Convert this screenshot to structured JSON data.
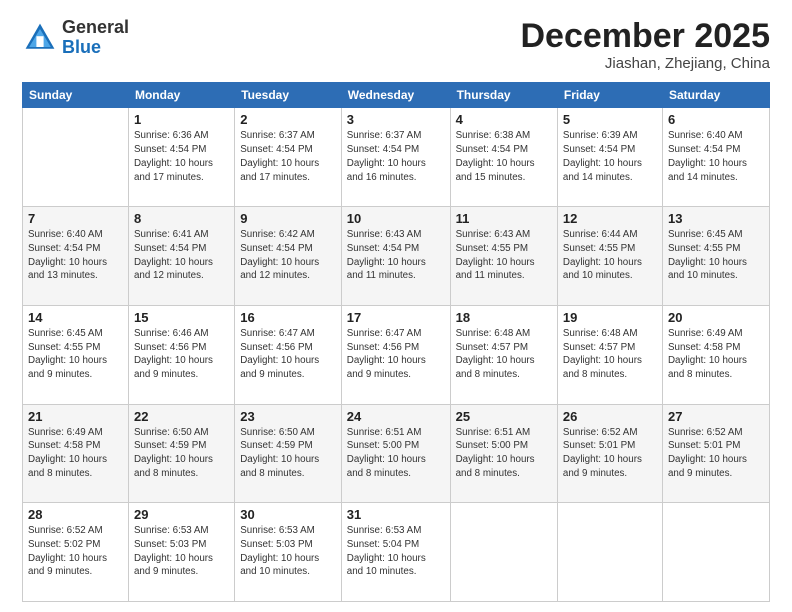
{
  "logo": {
    "general": "General",
    "blue": "Blue"
  },
  "title": {
    "month": "December 2025",
    "location": "Jiashan, Zhejiang, China"
  },
  "days_of_week": [
    "Sunday",
    "Monday",
    "Tuesday",
    "Wednesday",
    "Thursday",
    "Friday",
    "Saturday"
  ],
  "weeks": [
    [
      {
        "day": "",
        "info": ""
      },
      {
        "day": "1",
        "info": "Sunrise: 6:36 AM\nSunset: 4:54 PM\nDaylight: 10 hours\nand 17 minutes."
      },
      {
        "day": "2",
        "info": "Sunrise: 6:37 AM\nSunset: 4:54 PM\nDaylight: 10 hours\nand 17 minutes."
      },
      {
        "day": "3",
        "info": "Sunrise: 6:37 AM\nSunset: 4:54 PM\nDaylight: 10 hours\nand 16 minutes."
      },
      {
        "day": "4",
        "info": "Sunrise: 6:38 AM\nSunset: 4:54 PM\nDaylight: 10 hours\nand 15 minutes."
      },
      {
        "day": "5",
        "info": "Sunrise: 6:39 AM\nSunset: 4:54 PM\nDaylight: 10 hours\nand 14 minutes."
      },
      {
        "day": "6",
        "info": "Sunrise: 6:40 AM\nSunset: 4:54 PM\nDaylight: 10 hours\nand 14 minutes."
      }
    ],
    [
      {
        "day": "7",
        "info": "Sunrise: 6:40 AM\nSunset: 4:54 PM\nDaylight: 10 hours\nand 13 minutes."
      },
      {
        "day": "8",
        "info": "Sunrise: 6:41 AM\nSunset: 4:54 PM\nDaylight: 10 hours\nand 12 minutes."
      },
      {
        "day": "9",
        "info": "Sunrise: 6:42 AM\nSunset: 4:54 PM\nDaylight: 10 hours\nand 12 minutes."
      },
      {
        "day": "10",
        "info": "Sunrise: 6:43 AM\nSunset: 4:54 PM\nDaylight: 10 hours\nand 11 minutes."
      },
      {
        "day": "11",
        "info": "Sunrise: 6:43 AM\nSunset: 4:55 PM\nDaylight: 10 hours\nand 11 minutes."
      },
      {
        "day": "12",
        "info": "Sunrise: 6:44 AM\nSunset: 4:55 PM\nDaylight: 10 hours\nand 10 minutes."
      },
      {
        "day": "13",
        "info": "Sunrise: 6:45 AM\nSunset: 4:55 PM\nDaylight: 10 hours\nand 10 minutes."
      }
    ],
    [
      {
        "day": "14",
        "info": "Sunrise: 6:45 AM\nSunset: 4:55 PM\nDaylight: 10 hours\nand 9 minutes."
      },
      {
        "day": "15",
        "info": "Sunrise: 6:46 AM\nSunset: 4:56 PM\nDaylight: 10 hours\nand 9 minutes."
      },
      {
        "day": "16",
        "info": "Sunrise: 6:47 AM\nSunset: 4:56 PM\nDaylight: 10 hours\nand 9 minutes."
      },
      {
        "day": "17",
        "info": "Sunrise: 6:47 AM\nSunset: 4:56 PM\nDaylight: 10 hours\nand 9 minutes."
      },
      {
        "day": "18",
        "info": "Sunrise: 6:48 AM\nSunset: 4:57 PM\nDaylight: 10 hours\nand 8 minutes."
      },
      {
        "day": "19",
        "info": "Sunrise: 6:48 AM\nSunset: 4:57 PM\nDaylight: 10 hours\nand 8 minutes."
      },
      {
        "day": "20",
        "info": "Sunrise: 6:49 AM\nSunset: 4:58 PM\nDaylight: 10 hours\nand 8 minutes."
      }
    ],
    [
      {
        "day": "21",
        "info": "Sunrise: 6:49 AM\nSunset: 4:58 PM\nDaylight: 10 hours\nand 8 minutes."
      },
      {
        "day": "22",
        "info": "Sunrise: 6:50 AM\nSunset: 4:59 PM\nDaylight: 10 hours\nand 8 minutes."
      },
      {
        "day": "23",
        "info": "Sunrise: 6:50 AM\nSunset: 4:59 PM\nDaylight: 10 hours\nand 8 minutes."
      },
      {
        "day": "24",
        "info": "Sunrise: 6:51 AM\nSunset: 5:00 PM\nDaylight: 10 hours\nand 8 minutes."
      },
      {
        "day": "25",
        "info": "Sunrise: 6:51 AM\nSunset: 5:00 PM\nDaylight: 10 hours\nand 8 minutes."
      },
      {
        "day": "26",
        "info": "Sunrise: 6:52 AM\nSunset: 5:01 PM\nDaylight: 10 hours\nand 9 minutes."
      },
      {
        "day": "27",
        "info": "Sunrise: 6:52 AM\nSunset: 5:01 PM\nDaylight: 10 hours\nand 9 minutes."
      }
    ],
    [
      {
        "day": "28",
        "info": "Sunrise: 6:52 AM\nSunset: 5:02 PM\nDaylight: 10 hours\nand 9 minutes."
      },
      {
        "day": "29",
        "info": "Sunrise: 6:53 AM\nSunset: 5:03 PM\nDaylight: 10 hours\nand 9 minutes."
      },
      {
        "day": "30",
        "info": "Sunrise: 6:53 AM\nSunset: 5:03 PM\nDaylight: 10 hours\nand 10 minutes."
      },
      {
        "day": "31",
        "info": "Sunrise: 6:53 AM\nSunset: 5:04 PM\nDaylight: 10 hours\nand 10 minutes."
      },
      {
        "day": "",
        "info": ""
      },
      {
        "day": "",
        "info": ""
      },
      {
        "day": "",
        "info": ""
      }
    ]
  ]
}
